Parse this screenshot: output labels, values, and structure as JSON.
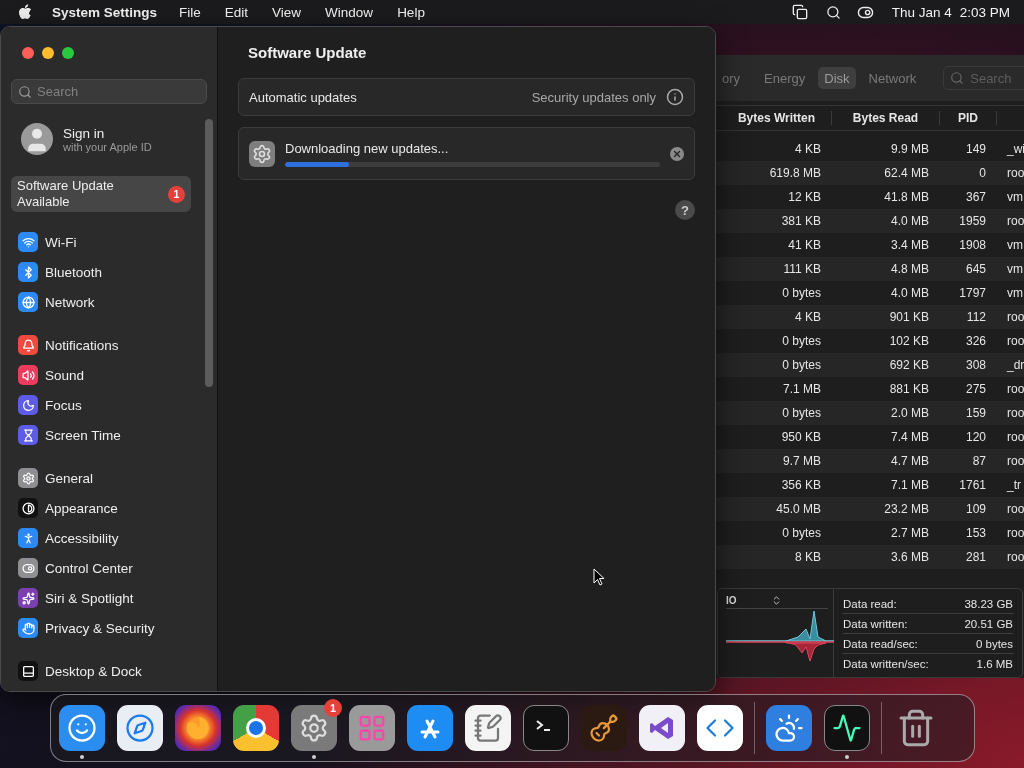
{
  "menu_bar": {
    "app_name": "System Settings",
    "items": [
      "File",
      "Edit",
      "View",
      "Window",
      "Help"
    ],
    "date": "Thu Jan 4",
    "time": "2:03 PM"
  },
  "settings": {
    "sidebar": {
      "search": {
        "placeholder": "Search"
      },
      "account": {
        "title": "Sign in",
        "subtitle": "with your Apple ID"
      },
      "update_item": {
        "label": "Software Update Available",
        "badge": "1",
        "selected": true
      },
      "groups": [
        [
          {
            "label": "Wi-Fi",
            "color": "#2b8af6",
            "selected": false
          },
          {
            "label": "Bluetooth",
            "color": "#2b8af6",
            "selected": false
          },
          {
            "label": "Network",
            "color": "#2b8af6",
            "selected": false
          }
        ],
        [
          {
            "label": "Notifications",
            "color": "#ee4a3f",
            "selected": false
          },
          {
            "label": "Sound",
            "color": "#ea3d5e",
            "selected": false
          },
          {
            "label": "Focus",
            "color": "#5e5ce6",
            "selected": false
          },
          {
            "label": "Screen Time",
            "color": "#5e5ce6",
            "selected": false
          }
        ],
        [
          {
            "label": "General",
            "color": "#8e8e93",
            "selected": false
          },
          {
            "label": "Appearance",
            "color": "#111111",
            "selected": false
          },
          {
            "label": "Accessibility",
            "color": "#2b8af6",
            "selected": false
          },
          {
            "label": "Control Center",
            "color": "#8e8e93",
            "selected": false
          },
          {
            "label": "Siri & Spotlight",
            "color": "#7b3fae",
            "selected": false
          },
          {
            "label": "Privacy & Security",
            "color": "#2b8af6",
            "selected": false
          }
        ],
        [
          {
            "label": "Desktop & Dock",
            "color": "#111111",
            "selected": false
          }
        ]
      ]
    },
    "title": "Software Update",
    "automatic": {
      "label": "Automatic updates",
      "value": "Security updates only"
    },
    "download": {
      "label": "Downloading new updates...",
      "level": 0.17
    },
    "help_button": "?"
  },
  "activity_monitor": {
    "tabs": [
      {
        "label": "ory",
        "selected": false
      },
      {
        "label": "Energy",
        "selected": false
      },
      {
        "label": "Disk",
        "selected": true
      },
      {
        "label": "Network",
        "selected": false
      }
    ],
    "search": {
      "placeholder": "Search"
    },
    "columns": [
      "Bytes Written",
      "Bytes Read",
      "PID"
    ],
    "rows": [
      {
        "bytes_written": "4 KB",
        "bytes_read": "9.9 MB",
        "pid": "149",
        "user": "_wi"
      },
      {
        "bytes_written": "619.8 MB",
        "bytes_read": "62.4 MB",
        "pid": "0",
        "user": "roo"
      },
      {
        "bytes_written": "12 KB",
        "bytes_read": "41.8 MB",
        "pid": "367",
        "user": "vm"
      },
      {
        "bytes_written": "381 KB",
        "bytes_read": "4.0 MB",
        "pid": "1959",
        "user": "roo"
      },
      {
        "bytes_written": "41 KB",
        "bytes_read": "3.4 MB",
        "pid": "1908",
        "user": "vm"
      },
      {
        "bytes_written": "111 KB",
        "bytes_read": "4.8 MB",
        "pid": "645",
        "user": "vm"
      },
      {
        "bytes_written": "0 bytes",
        "bytes_read": "4.0 MB",
        "pid": "1797",
        "user": "vm"
      },
      {
        "bytes_written": "4 KB",
        "bytes_read": "901 KB",
        "pid": "112",
        "user": "roo"
      },
      {
        "bytes_written": "0 bytes",
        "bytes_read": "102 KB",
        "pid": "326",
        "user": "roo"
      },
      {
        "bytes_written": "0 bytes",
        "bytes_read": "692 KB",
        "pid": "308",
        "user": "_dr"
      },
      {
        "bytes_written": "7.1 MB",
        "bytes_read": "881 KB",
        "pid": "275",
        "user": "roo"
      },
      {
        "bytes_written": "0 bytes",
        "bytes_read": "2.0 MB",
        "pid": "159",
        "user": "roo"
      },
      {
        "bytes_written": "950 KB",
        "bytes_read": "7.4 MB",
        "pid": "120",
        "user": "roo"
      },
      {
        "bytes_written": "9.7 MB",
        "bytes_read": "4.7 MB",
        "pid": "87",
        "user": "roo"
      },
      {
        "bytes_written": "356 KB",
        "bytes_read": "7.1 MB",
        "pid": "1761",
        "user": "_tr"
      },
      {
        "bytes_written": "45.0 MB",
        "bytes_read": "23.2 MB",
        "pid": "109",
        "user": "roo"
      },
      {
        "bytes_written": "0 bytes",
        "bytes_read": "2.7 MB",
        "pid": "153",
        "user": "roo"
      },
      {
        "bytes_written": "8 KB",
        "bytes_read": "3.6 MB",
        "pid": "281",
        "user": "roo"
      }
    ],
    "graph_selector": "IO",
    "stats": [
      {
        "label": "Data read:",
        "value": "38.23 GB"
      },
      {
        "label": "Data written:",
        "value": "20.51 GB"
      },
      {
        "label": "Data read/sec:",
        "value": "0 bytes"
      },
      {
        "label": "Data written/sec:",
        "value": "1.6 MB"
      }
    ]
  },
  "dock": {
    "items": [
      {
        "running": true
      },
      {
        "running": false
      },
      {
        "running": false
      },
      {
        "running": false
      },
      {
        "running": true,
        "badge": "1"
      },
      {
        "running": false
      },
      {
        "running": false
      },
      {
        "running": false
      },
      {
        "running": false
      },
      {
        "running": false
      },
      {
        "running": false
      },
      {
        "running": false
      },
      {
        "running": false
      },
      {
        "running": true
      },
      {
        "running": false
      }
    ]
  }
}
